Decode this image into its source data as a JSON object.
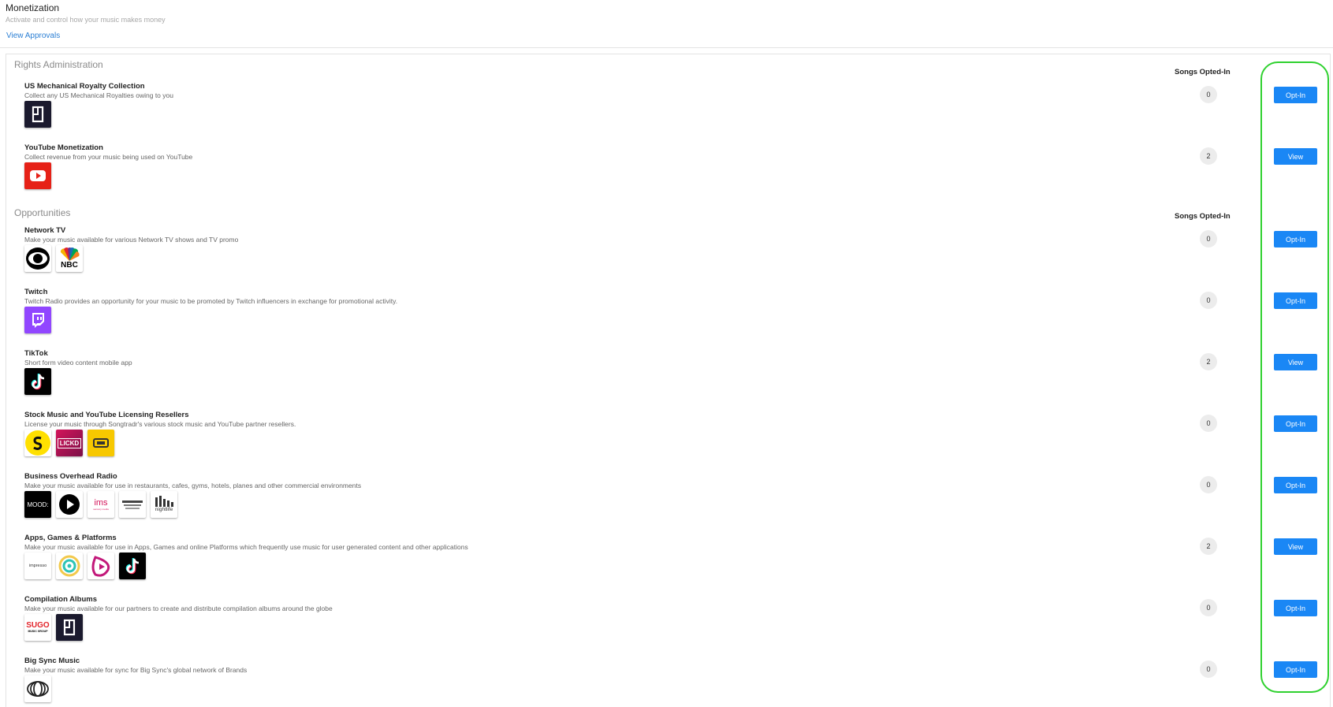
{
  "header": {
    "title": "Monetization",
    "subtitle": "Activate and control how your music makes money",
    "view_approvals": "View Approvals"
  },
  "sections": {
    "rights": {
      "title": "Rights Administration",
      "column_header": "Songs Opted-In"
    },
    "opportunities": {
      "title": "Opportunities",
      "column_header": "Songs Opted-In"
    }
  },
  "items": [
    {
      "name": "US Mechanical Royalty Collection",
      "desc": "Collect any US Mechanical Royalties owing to you",
      "count": "0",
      "action": "Opt-In",
      "logos": [
        "songtradr-logo"
      ]
    },
    {
      "name": "YouTube Monetization",
      "desc": "Collect revenue from your music being used on YouTube",
      "count": "2",
      "action": "View",
      "logos": [
        "youtube-logo"
      ]
    },
    {
      "name": "Network TV",
      "desc": "Make your music available for various Network TV shows and TV promo",
      "count": "0",
      "action": "Opt-In",
      "logos": [
        "cbs-logo",
        "nbc-logo"
      ],
      "logo_text": {
        "nbc": "NBC"
      }
    },
    {
      "name": "Twitch",
      "desc": "Twitch Radio provides an opportunity for your music to be promoted by Twitch influencers in exchange for promotional activity.",
      "count": "0",
      "action": "Opt-In",
      "logos": [
        "twitch-logo"
      ]
    },
    {
      "name": "TikTok",
      "desc": "Short form video content mobile app",
      "count": "2",
      "action": "View",
      "logos": [
        "tiktok-logo"
      ]
    },
    {
      "name": "Stock Music and YouTube Licensing Resellers",
      "desc": "License your music through Songtradr's various stock music and YouTube partner resellers.",
      "count": "0",
      "action": "Opt-In",
      "logos": [
        "stock-s-logo",
        "lickd-logo",
        "reseller-logo"
      ],
      "logo_text": {
        "lickd": "LICKD"
      }
    },
    {
      "name": "Business Overhead Radio",
      "desc": "Make your music available for use in restaurants, cafes, gyms, hotels, planes and other commercial environments",
      "count": "0",
      "action": "Opt-In",
      "logos": [
        "mood-logo",
        "play-logo",
        "ims-logo",
        "musicstore-logo",
        "nightlife-logo"
      ],
      "logo_text": {
        "mood": "MOOD:",
        "ims": "ims",
        "ims_sub": "sensory media",
        "nightlife": "nightlife"
      }
    },
    {
      "name": "Apps, Games & Platforms",
      "desc": "Make your music available for use in Apps, Games and online Platforms which frequently use music for user generated content and other applications",
      "count": "2",
      "action": "View",
      "logos": [
        "impresso-logo",
        "spiral-logo",
        "triller-logo",
        "tiktok-logo"
      ],
      "logo_text": {
        "impresso": "impresso"
      }
    },
    {
      "name": "Compilation Albums",
      "desc": "Make your music available for our partners to create and distribute compilation albums around the globe",
      "count": "0",
      "action": "Opt-In",
      "logos": [
        "sugo-logo",
        "songtradr-logo"
      ],
      "logo_text": {
        "sugo": "SUGO",
        "sugo_sub": "MUSIC GROUP"
      }
    },
    {
      "name": "Big Sync Music",
      "desc": "Make your music available for sync for Big Sync's global network of Brands",
      "count": "0",
      "action": "Opt-In",
      "logos": [
        "bigsync-logo"
      ]
    }
  ],
  "colors": {
    "accent": "#1a87f5",
    "link": "#2b7fd4",
    "highlight": "#2fd12f"
  }
}
